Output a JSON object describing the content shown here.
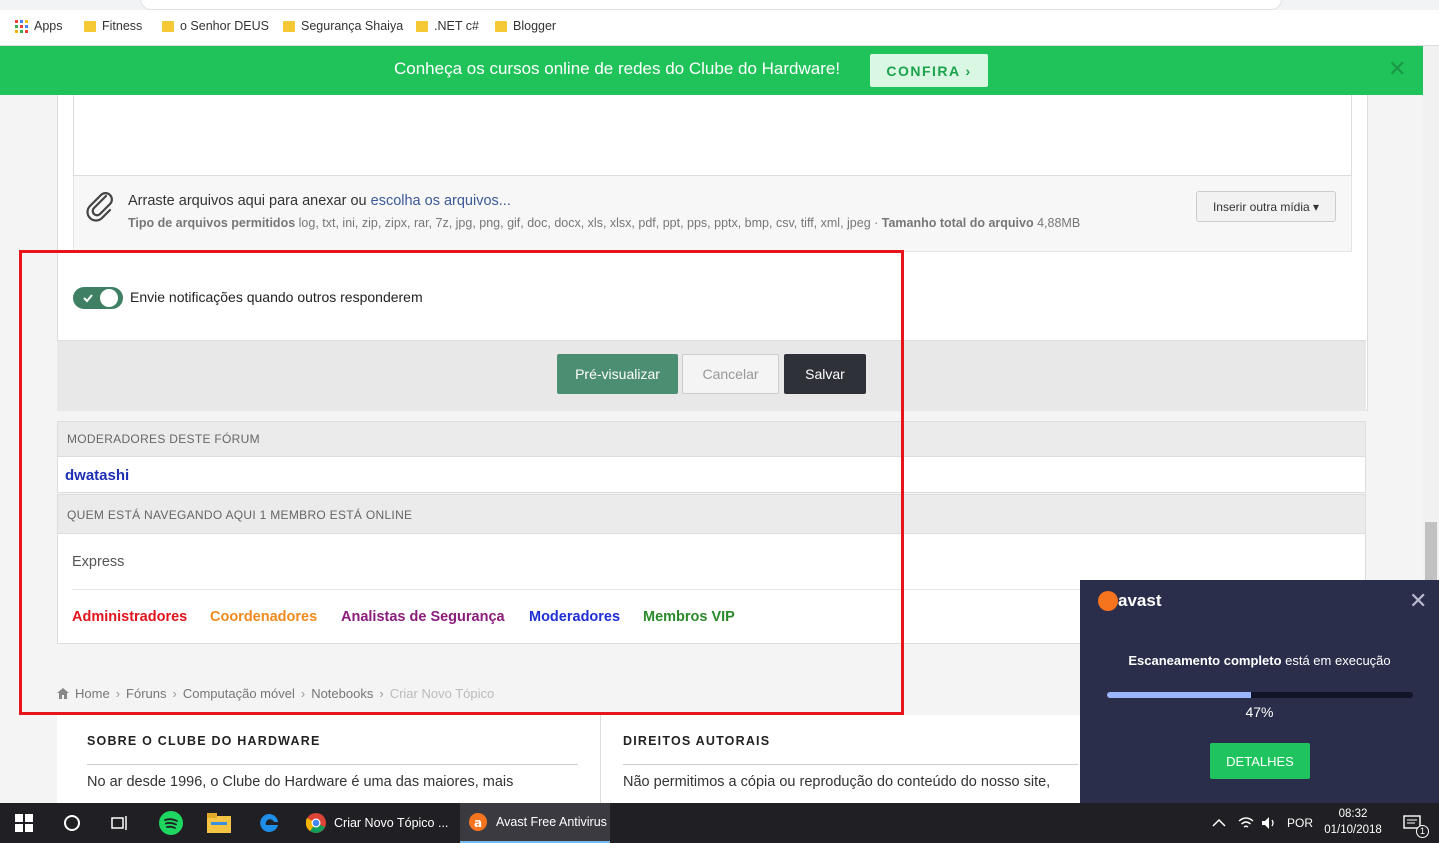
{
  "bookmarks": [
    {
      "label": "Apps",
      "icon": "apps-grid-icon"
    },
    {
      "label": "Fitness",
      "icon": "folder-icon"
    },
    {
      "label": "o Senhor DEUS",
      "icon": "folder-icon"
    },
    {
      "label": "Segurança Shaiya",
      "icon": "folder-icon"
    },
    {
      "label": ".NET c#",
      "icon": "folder-icon"
    },
    {
      "label": "Blogger",
      "icon": "folder-icon"
    }
  ],
  "banner": {
    "text": "Conheça os cursos online de redes do Clube do Hardware!",
    "cta": "CONFIRA ›",
    "close": "✕",
    "color": "#20c35a"
  },
  "attach": {
    "prefix": "Arraste arquivos aqui para anexar ou ",
    "link": "escolha os arquivos...",
    "types_label": "Tipo de arquivos permitidos",
    "types": " log, txt, ini, zip, zipx, rar, 7z, jpg, png, gif, doc, docx, xls, xlsx, pdf, ppt, pps, pptx, bmp, csv, tiff, xml, jpeg · ",
    "size_label": "Tamanho total do arquivo",
    "size": " 4,88MB",
    "insert_button": "Inserir outra mídia ▾"
  },
  "notify": {
    "label": "Envie notificações quando outros responderem",
    "enabled": true
  },
  "actions": {
    "preview": "Pré-visualizar",
    "cancel": "Cancelar",
    "save": "Salvar"
  },
  "moderators": {
    "title": "MODERADORES DESTE FÓRUM",
    "names": [
      "dwatashi"
    ]
  },
  "online": {
    "title": "QUEM ESTÁ NAVEGANDO AQUI   1 MEMBRO ESTÁ ONLINE",
    "users": [
      "Express"
    ],
    "legend": [
      {
        "label": "Administradores",
        "color": "#e0141c"
      },
      {
        "label": "Coordenadores",
        "color": "#f08a1c"
      },
      {
        "label": "Analistas de Segurança",
        "color": "#8a1c7c"
      },
      {
        "label": "Moderadores",
        "color": "#1e2fd4"
      },
      {
        "label": "Membros VIP",
        "color": "#2a8a2a"
      }
    ]
  },
  "breadcrumb": [
    "Home",
    "Fóruns",
    "Computação móvel",
    "Notebooks",
    "Criar Novo Tópico"
  ],
  "footer": {
    "left_title": "SOBRE O CLUBE DO HARDWARE",
    "left_text": "No ar desde 1996, o Clube do Hardware é uma das maiores, mais",
    "right_title": "DIREITOS AUTORAIS",
    "right_text": "Não permitimos a cópia ou reprodução do conteúdo do nosso site,"
  },
  "avast": {
    "brand": "avast",
    "message_bold": "Escaneamento completo",
    "message_rest": " está em execução",
    "progress": 0.47,
    "progress_text": "47%",
    "button": "DETALHES"
  },
  "taskbar": {
    "apps": [
      {
        "label": "Criar Novo Tópico ...",
        "icon": "chrome-icon"
      },
      {
        "label": "Avast Free Antivirus",
        "icon": "avast-icon"
      }
    ],
    "lang": "POR",
    "time": "08:32",
    "date": "01/10/2018",
    "notif_count": "1"
  }
}
